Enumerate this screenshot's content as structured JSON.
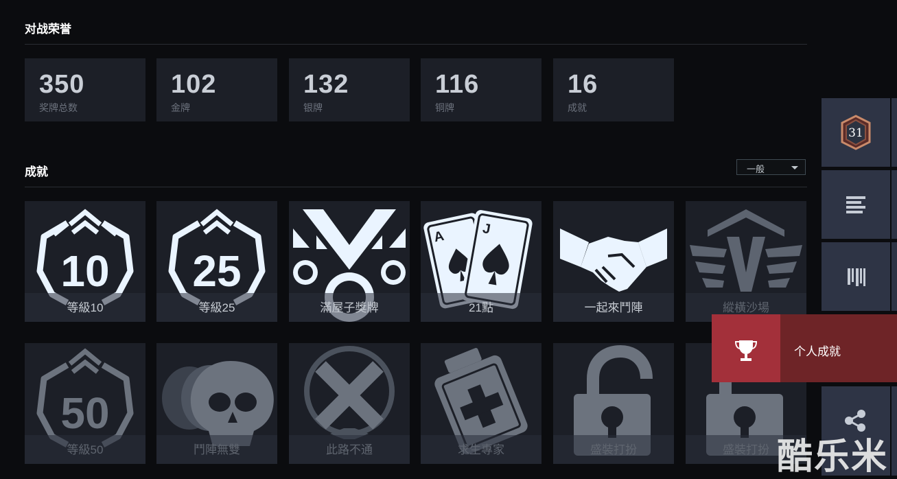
{
  "honors": {
    "title": "对战荣誉"
  },
  "stats": [
    {
      "value": "350",
      "label": "奖牌总数"
    },
    {
      "value": "102",
      "label": "金牌"
    },
    {
      "value": "132",
      "label": "银牌"
    },
    {
      "value": "116",
      "label": "铜牌"
    },
    {
      "value": "16",
      "label": "成就"
    }
  ],
  "achievements": {
    "title": "成就",
    "filter": {
      "selected": "一般"
    },
    "items": [
      {
        "name": "等級10",
        "unlocked": true,
        "icon": "level-badge-icon"
      },
      {
        "name": "等級25",
        "unlocked": true,
        "icon": "level-badge-icon"
      },
      {
        "name": "滿屋子獎牌",
        "unlocked": true,
        "icon": "medals-icon"
      },
      {
        "name": "21點",
        "unlocked": true,
        "icon": "playing-cards-icon"
      },
      {
        "name": "一起來鬥陣",
        "unlocked": true,
        "icon": "handshake-icon"
      },
      {
        "name": "縱橫沙場",
        "unlocked": false,
        "icon": "winged-v-icon"
      },
      {
        "name": "等級50",
        "unlocked": false,
        "icon": "level-badge-icon"
      },
      {
        "name": "鬥陣無雙",
        "unlocked": false,
        "icon": "skulls-icon"
      },
      {
        "name": "此路不通",
        "unlocked": false,
        "icon": "blocked-x-icon"
      },
      {
        "name": "求生專家",
        "unlocked": false,
        "icon": "medkit-icon"
      },
      {
        "name": "盛裝打扮",
        "unlocked": false,
        "icon": "padlock-icon"
      },
      {
        "name": "盛裝打扮",
        "unlocked": false,
        "icon": "padlock-icon"
      }
    ]
  },
  "sidebar": {
    "level_badge": "31",
    "buttons": [
      "level-badge-icon",
      "list-icon",
      "barcode-icon",
      "share-icon"
    ]
  },
  "popup": {
    "label": "个人成就",
    "icon": "trophy-icon"
  },
  "watermark": {
    "text": "酷乐米"
  },
  "colors": {
    "background": "#0b0c0f",
    "card": "#1c1f27",
    "unlocked_icon": "#eaf4ff",
    "locked_icon": "#6c737e",
    "sidebar": "#2e3445",
    "popup_accent": "#a3303a"
  }
}
